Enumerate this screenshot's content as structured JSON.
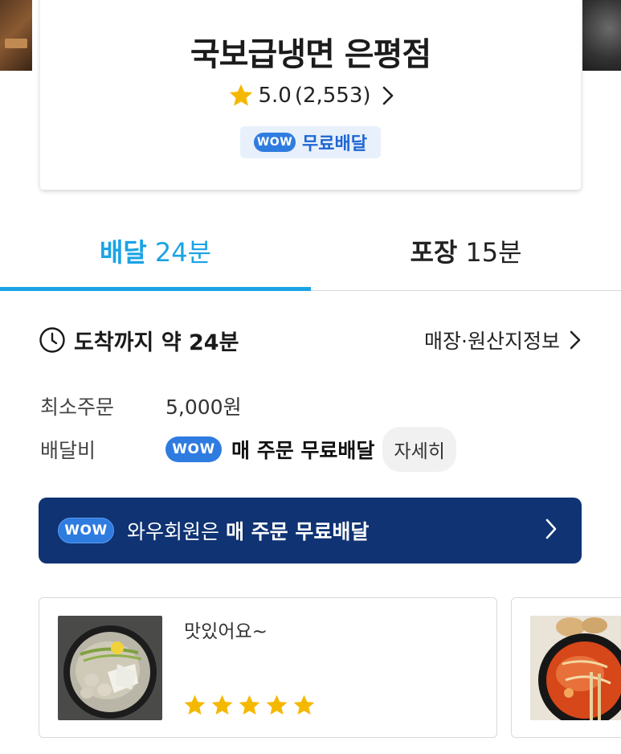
{
  "store": {
    "name": "국보급냉면 은평점",
    "rating": "5.0",
    "review_count": "(2,553)",
    "wow_label": "WOW",
    "free_delivery": "무료배달"
  },
  "tabs": [
    {
      "label": "배달",
      "time": "24분",
      "active": true
    },
    {
      "label": "포장",
      "time": "15분",
      "active": false
    }
  ],
  "eta": {
    "text": "도착까지 약 24분",
    "info_link": "매장·원산지정보"
  },
  "info": {
    "min_order_label": "최소주문",
    "min_order_value": "5,000원",
    "fee_label": "배달비",
    "fee_wow": "WOW",
    "fee_value": "매 주문 무료배달",
    "detail_button": "자세히"
  },
  "wow_banner": {
    "badge": "WOW",
    "prefix": "와우회원은 ",
    "highlight": "매 주문 무료배달"
  },
  "reviews": [
    {
      "text": "맛있어요~",
      "stars": 5
    }
  ],
  "colors": {
    "accent": "#1ba3e4",
    "wow_blue": "#2f7ce0",
    "banner_navy": "#0f3373",
    "star": "#f5b800"
  }
}
